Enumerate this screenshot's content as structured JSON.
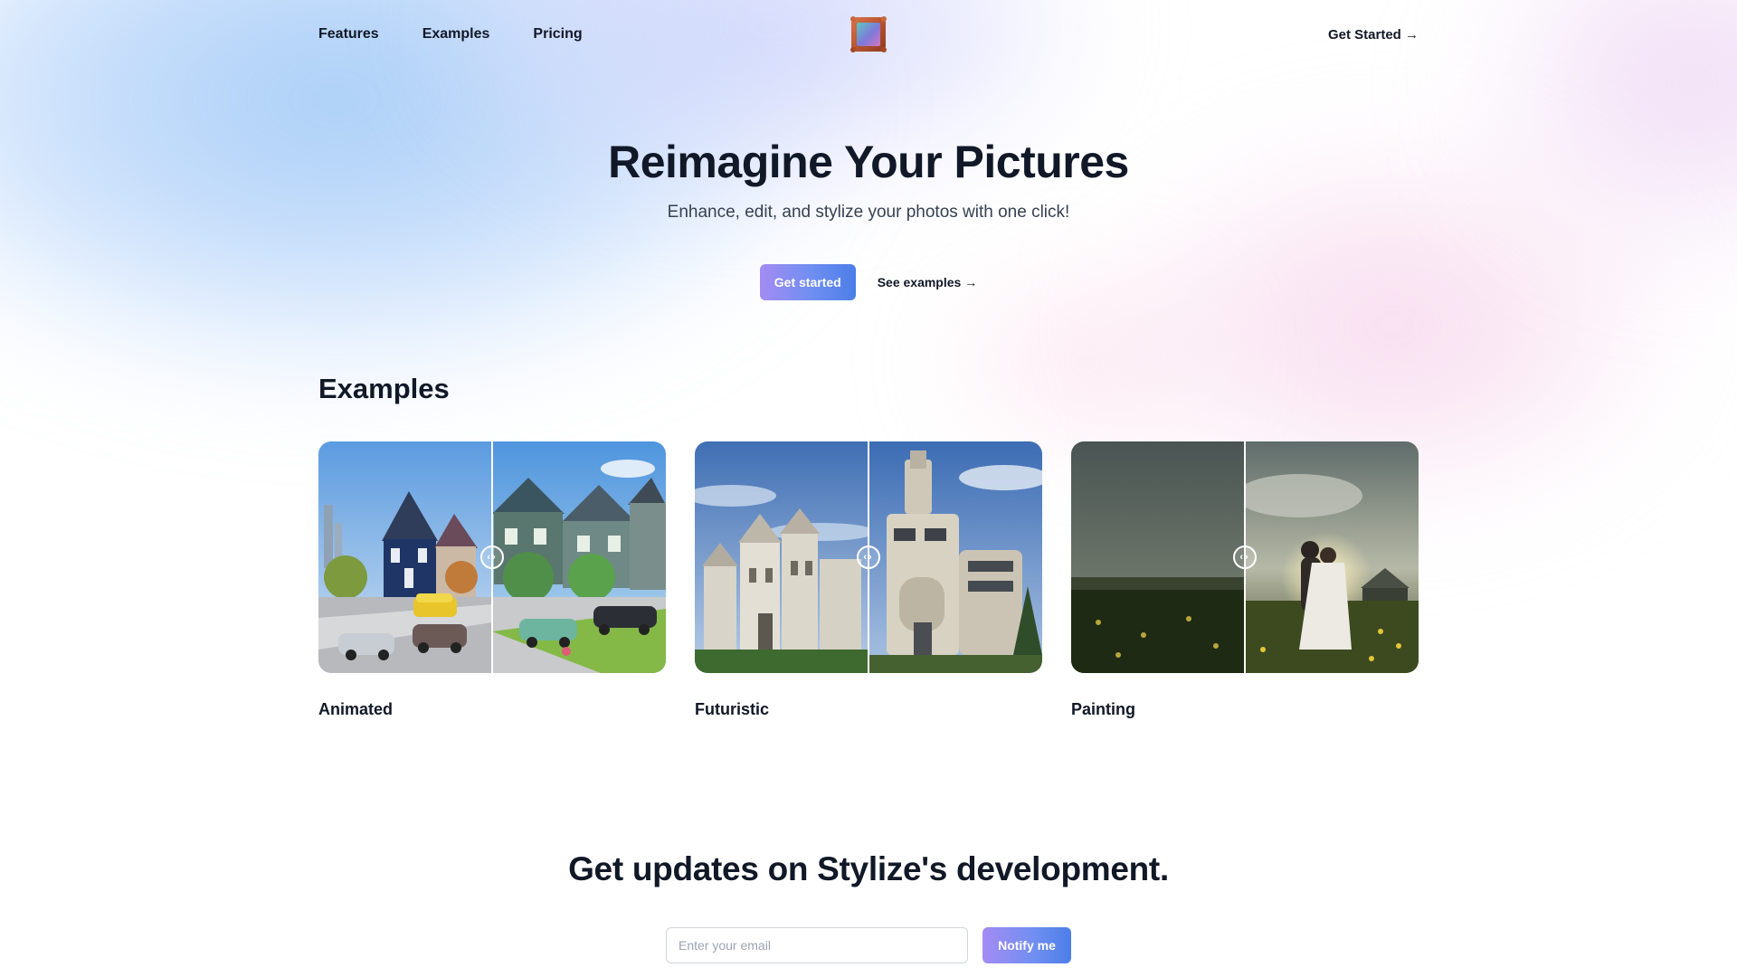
{
  "nav": {
    "links": [
      "Features",
      "Examples",
      "Pricing"
    ],
    "logo_icon": "picture-frame-icon",
    "cta": "Get Started →"
  },
  "hero": {
    "title": "Reimagine Your Pictures",
    "subtitle": "Enhance, edit, and stylize your photos with one click!",
    "primary_button": "Get started",
    "secondary_link": "See examples →"
  },
  "examples": {
    "title": "Examples",
    "cards": [
      {
        "label": "Animated"
      },
      {
        "label": "Futuristic"
      },
      {
        "label": "Painting"
      }
    ]
  },
  "updates": {
    "title": "Get updates on Stylize's development.",
    "email_placeholder": "Enter your email",
    "email_value": "",
    "button": "Notify me"
  },
  "colors": {
    "accent_start": "#a38cf3",
    "accent_end": "#4c7ee8",
    "text": "#111827"
  }
}
